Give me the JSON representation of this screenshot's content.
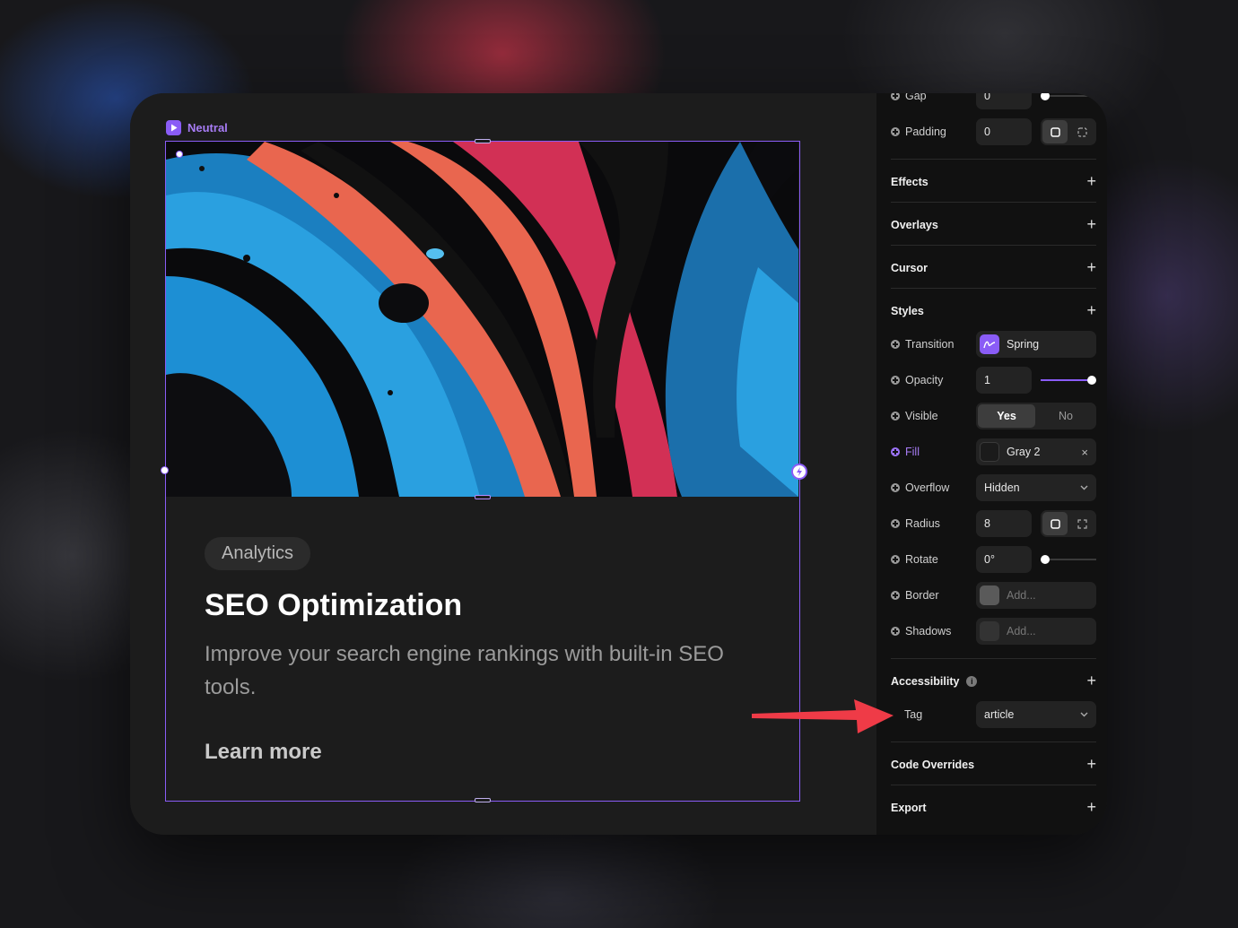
{
  "frame": {
    "label": "Neutral"
  },
  "card": {
    "badge": "Analytics",
    "title": "SEO Optimization",
    "description": "Improve your search engine rankings with built-in SEO tools.",
    "link": "Learn more"
  },
  "panel": {
    "gap": {
      "label": "Gap",
      "value": "0"
    },
    "padding": {
      "label": "Padding",
      "value": "0"
    },
    "sections": {
      "effects": "Effects",
      "overlays": "Overlays",
      "cursor": "Cursor",
      "styles": "Styles",
      "accessibility": "Accessibility",
      "code_overrides": "Code Overrides",
      "export": "Export"
    },
    "transition": {
      "label": "Transition",
      "value": "Spring"
    },
    "opacity": {
      "label": "Opacity",
      "value": "1",
      "level": 1.0
    },
    "visible": {
      "label": "Visible",
      "yes": "Yes",
      "no": "No"
    },
    "fill": {
      "label": "Fill",
      "value": "Gray 2",
      "clear": "×"
    },
    "overflow": {
      "label": "Overflow",
      "value": "Hidden"
    },
    "radius": {
      "label": "Radius",
      "value": "8"
    },
    "rotate": {
      "label": "Rotate",
      "value": "0°"
    },
    "border": {
      "label": "Border",
      "placeholder": "Add..."
    },
    "shadows": {
      "label": "Shadows",
      "placeholder": "Add..."
    },
    "tag": {
      "label": "Tag",
      "value": "article"
    },
    "add_symbol": "+"
  },
  "colors": {
    "accent": "#8a5cf6",
    "arrow": "#ef3b47"
  }
}
